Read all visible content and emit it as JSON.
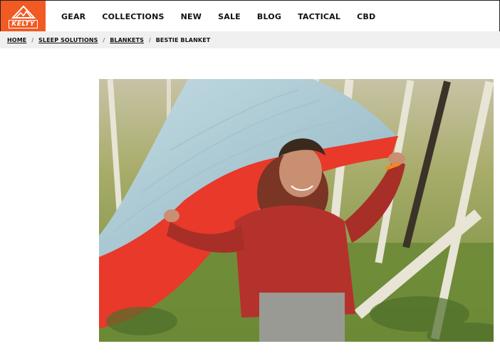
{
  "brand": {
    "name": "KELTY",
    "color": "#f15a22"
  },
  "nav": {
    "items": [
      "GEAR",
      "COLLECTIONS",
      "NEW",
      "SALE",
      "BLOG",
      "TACTICAL",
      "CBD"
    ]
  },
  "breadcrumb": {
    "items": [
      "HOME",
      "SLEEP SOLUTIONS",
      "BLANKETS",
      "BESTIE BLANKET"
    ],
    "separator": "/"
  },
  "hero": {
    "image": "product-lifestyle-photo",
    "colors": {
      "blanket_outer": "#e8392b",
      "blanket_inner": "#a9c8d3",
      "shirt": "#b5322c"
    }
  }
}
